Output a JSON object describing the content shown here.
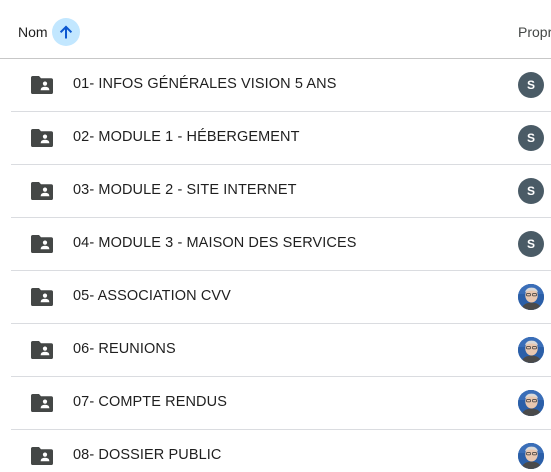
{
  "header": {
    "name_column": "Nom",
    "sort_direction_icon": "arrow-up-icon",
    "owner_column": "Propriétaire"
  },
  "accent_colors": {
    "sort_chip": "#c2e7ff",
    "sort_arrow": "#0b57d0"
  },
  "rows": [
    {
      "name": "01- INFOS GÉNÉRALES VISION 5 ANS",
      "owner": {
        "type": "letter",
        "letter": "S"
      }
    },
    {
      "name": "02- MODULE 1 - HÉBERGEMENT",
      "owner": {
        "type": "letter",
        "letter": "S"
      }
    },
    {
      "name": "03- MODULE 2 - SITE INTERNET",
      "owner": {
        "type": "letter",
        "letter": "S"
      }
    },
    {
      "name": "04- MODULE 3 - MAISON DES SERVICES",
      "owner": {
        "type": "letter",
        "letter": "S"
      }
    },
    {
      "name": "05- ASSOCIATION CVV",
      "owner": {
        "type": "photo",
        "letter": ""
      }
    },
    {
      "name": "06- REUNIONS",
      "owner": {
        "type": "photo",
        "letter": ""
      }
    },
    {
      "name": "07- COMPTE RENDUS",
      "owner": {
        "type": "photo",
        "letter": ""
      }
    },
    {
      "name": "08- DOSSIER PUBLIC",
      "owner": {
        "type": "photo",
        "letter": ""
      }
    }
  ]
}
